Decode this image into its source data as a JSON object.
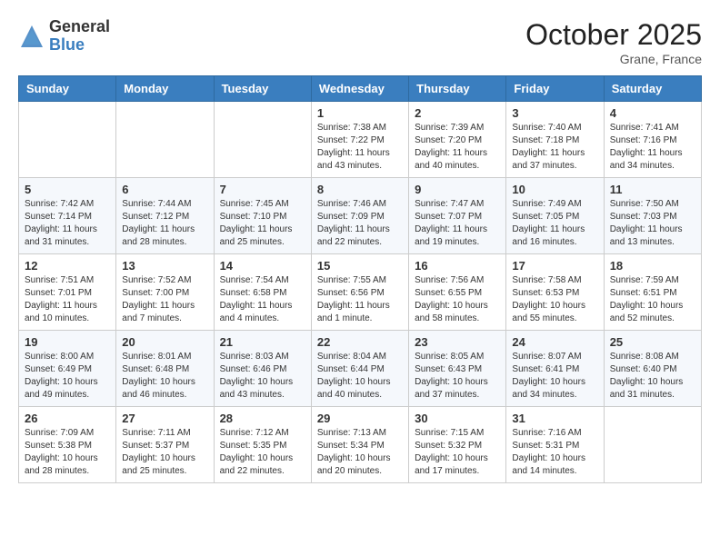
{
  "header": {
    "logo_general": "General",
    "logo_blue": "Blue",
    "month_title": "October 2025",
    "location": "Grane, France"
  },
  "weekdays": [
    "Sunday",
    "Monday",
    "Tuesday",
    "Wednesday",
    "Thursday",
    "Friday",
    "Saturday"
  ],
  "weeks": [
    [
      {
        "day": "",
        "info": ""
      },
      {
        "day": "",
        "info": ""
      },
      {
        "day": "",
        "info": ""
      },
      {
        "day": "1",
        "info": "Sunrise: 7:38 AM\nSunset: 7:22 PM\nDaylight: 11 hours\nand 43 minutes."
      },
      {
        "day": "2",
        "info": "Sunrise: 7:39 AM\nSunset: 7:20 PM\nDaylight: 11 hours\nand 40 minutes."
      },
      {
        "day": "3",
        "info": "Sunrise: 7:40 AM\nSunset: 7:18 PM\nDaylight: 11 hours\nand 37 minutes."
      },
      {
        "day": "4",
        "info": "Sunrise: 7:41 AM\nSunset: 7:16 PM\nDaylight: 11 hours\nand 34 minutes."
      }
    ],
    [
      {
        "day": "5",
        "info": "Sunrise: 7:42 AM\nSunset: 7:14 PM\nDaylight: 11 hours\nand 31 minutes."
      },
      {
        "day": "6",
        "info": "Sunrise: 7:44 AM\nSunset: 7:12 PM\nDaylight: 11 hours\nand 28 minutes."
      },
      {
        "day": "7",
        "info": "Sunrise: 7:45 AM\nSunset: 7:10 PM\nDaylight: 11 hours\nand 25 minutes."
      },
      {
        "day": "8",
        "info": "Sunrise: 7:46 AM\nSunset: 7:09 PM\nDaylight: 11 hours\nand 22 minutes."
      },
      {
        "day": "9",
        "info": "Sunrise: 7:47 AM\nSunset: 7:07 PM\nDaylight: 11 hours\nand 19 minutes."
      },
      {
        "day": "10",
        "info": "Sunrise: 7:49 AM\nSunset: 7:05 PM\nDaylight: 11 hours\nand 16 minutes."
      },
      {
        "day": "11",
        "info": "Sunrise: 7:50 AM\nSunset: 7:03 PM\nDaylight: 11 hours\nand 13 minutes."
      }
    ],
    [
      {
        "day": "12",
        "info": "Sunrise: 7:51 AM\nSunset: 7:01 PM\nDaylight: 11 hours\nand 10 minutes."
      },
      {
        "day": "13",
        "info": "Sunrise: 7:52 AM\nSunset: 7:00 PM\nDaylight: 11 hours\nand 7 minutes."
      },
      {
        "day": "14",
        "info": "Sunrise: 7:54 AM\nSunset: 6:58 PM\nDaylight: 11 hours\nand 4 minutes."
      },
      {
        "day": "15",
        "info": "Sunrise: 7:55 AM\nSunset: 6:56 PM\nDaylight: 11 hours\nand 1 minute."
      },
      {
        "day": "16",
        "info": "Sunrise: 7:56 AM\nSunset: 6:55 PM\nDaylight: 10 hours\nand 58 minutes."
      },
      {
        "day": "17",
        "info": "Sunrise: 7:58 AM\nSunset: 6:53 PM\nDaylight: 10 hours\nand 55 minutes."
      },
      {
        "day": "18",
        "info": "Sunrise: 7:59 AM\nSunset: 6:51 PM\nDaylight: 10 hours\nand 52 minutes."
      }
    ],
    [
      {
        "day": "19",
        "info": "Sunrise: 8:00 AM\nSunset: 6:49 PM\nDaylight: 10 hours\nand 49 minutes."
      },
      {
        "day": "20",
        "info": "Sunrise: 8:01 AM\nSunset: 6:48 PM\nDaylight: 10 hours\nand 46 minutes."
      },
      {
        "day": "21",
        "info": "Sunrise: 8:03 AM\nSunset: 6:46 PM\nDaylight: 10 hours\nand 43 minutes."
      },
      {
        "day": "22",
        "info": "Sunrise: 8:04 AM\nSunset: 6:44 PM\nDaylight: 10 hours\nand 40 minutes."
      },
      {
        "day": "23",
        "info": "Sunrise: 8:05 AM\nSunset: 6:43 PM\nDaylight: 10 hours\nand 37 minutes."
      },
      {
        "day": "24",
        "info": "Sunrise: 8:07 AM\nSunset: 6:41 PM\nDaylight: 10 hours\nand 34 minutes."
      },
      {
        "day": "25",
        "info": "Sunrise: 8:08 AM\nSunset: 6:40 PM\nDaylight: 10 hours\nand 31 minutes."
      }
    ],
    [
      {
        "day": "26",
        "info": "Sunrise: 7:09 AM\nSunset: 5:38 PM\nDaylight: 10 hours\nand 28 minutes."
      },
      {
        "day": "27",
        "info": "Sunrise: 7:11 AM\nSunset: 5:37 PM\nDaylight: 10 hours\nand 25 minutes."
      },
      {
        "day": "28",
        "info": "Sunrise: 7:12 AM\nSunset: 5:35 PM\nDaylight: 10 hours\nand 22 minutes."
      },
      {
        "day": "29",
        "info": "Sunrise: 7:13 AM\nSunset: 5:34 PM\nDaylight: 10 hours\nand 20 minutes."
      },
      {
        "day": "30",
        "info": "Sunrise: 7:15 AM\nSunset: 5:32 PM\nDaylight: 10 hours\nand 17 minutes."
      },
      {
        "day": "31",
        "info": "Sunrise: 7:16 AM\nSunset: 5:31 PM\nDaylight: 10 hours\nand 14 minutes."
      },
      {
        "day": "",
        "info": ""
      }
    ]
  ]
}
